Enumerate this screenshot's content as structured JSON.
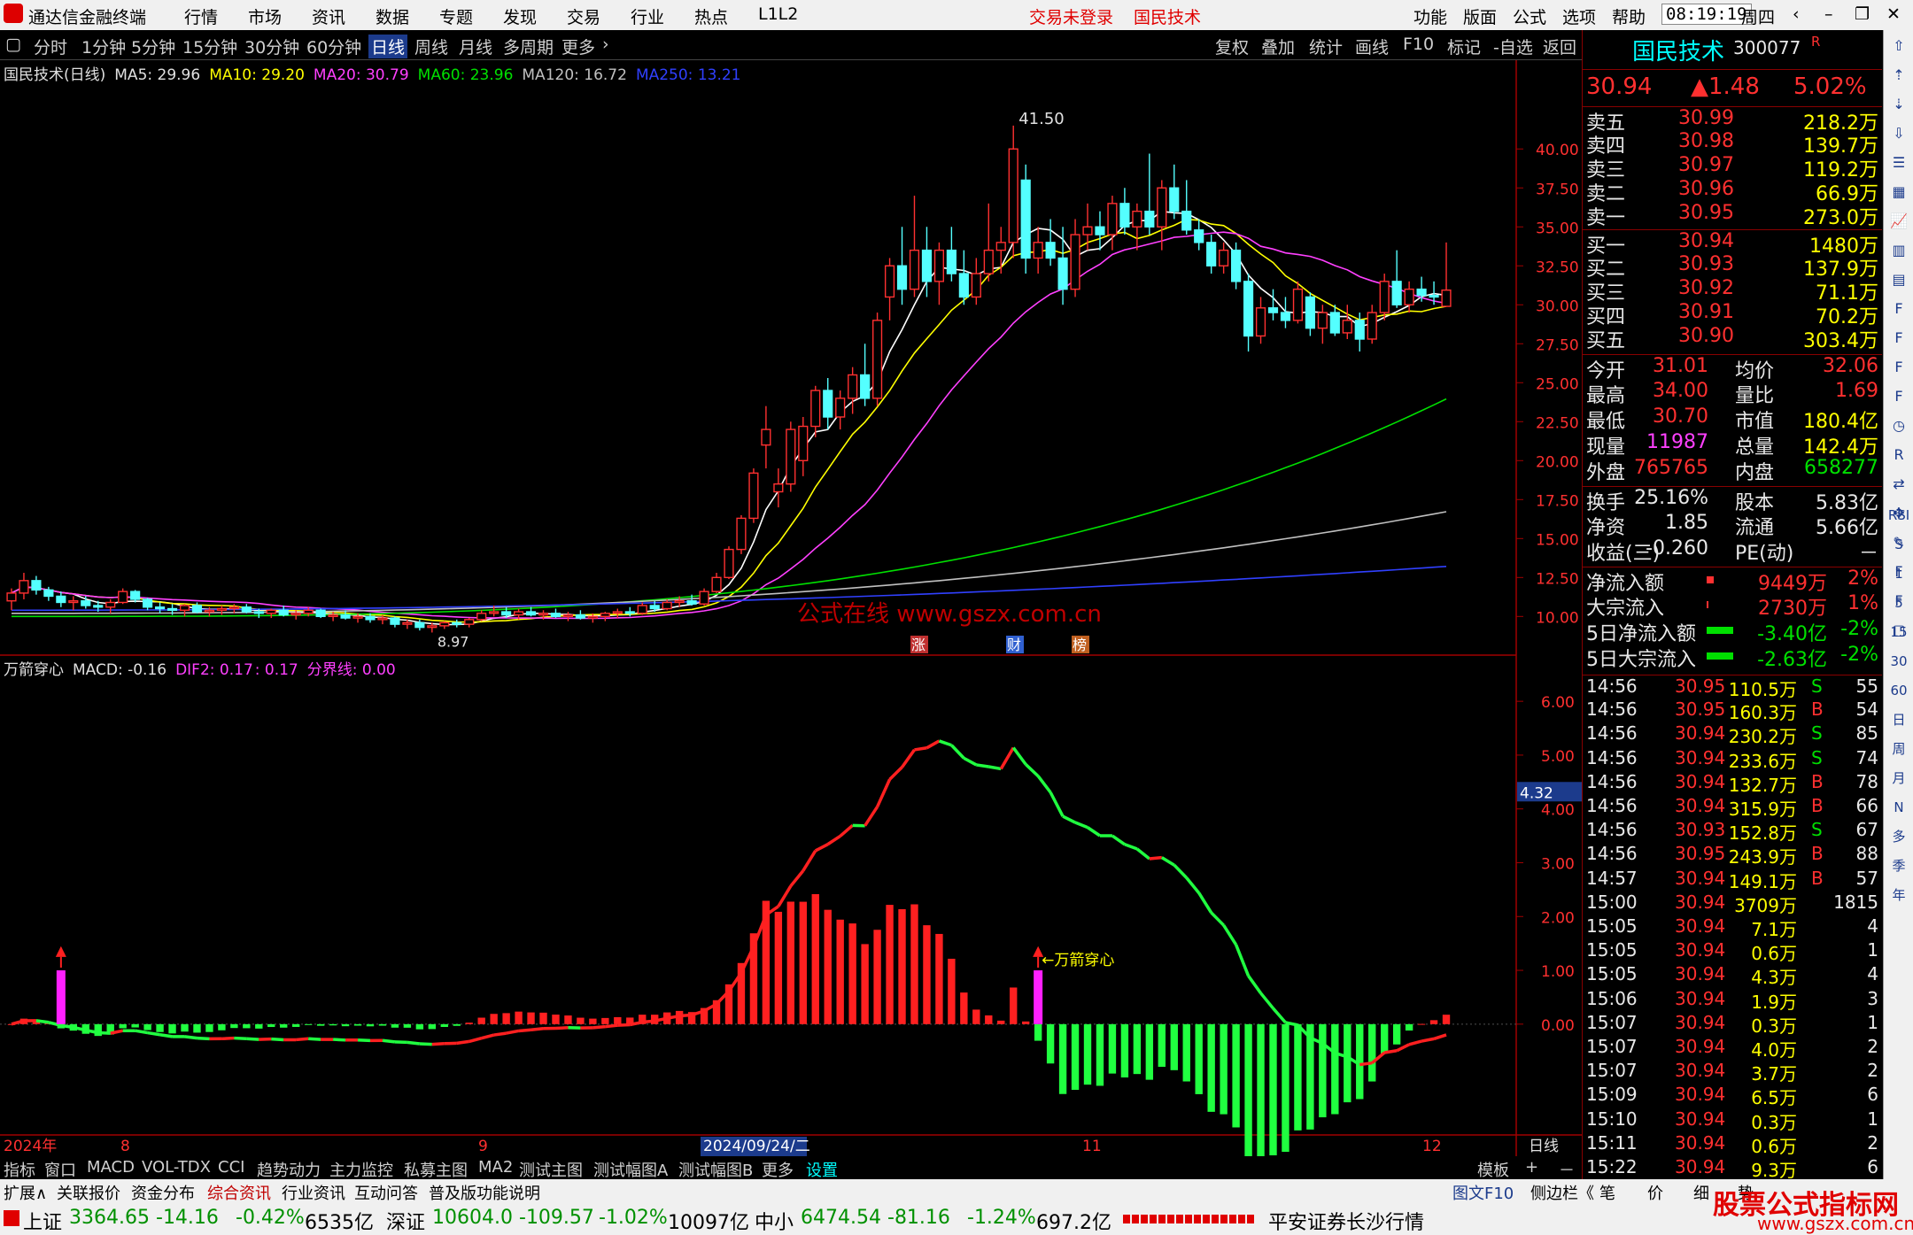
{
  "app": {
    "title": "通达信金融终端",
    "menus": [
      "行情",
      "市场",
      "资讯",
      "数据",
      "专题",
      "发现",
      "交易",
      "行业",
      "热点",
      "L1L2"
    ],
    "login_status": "交易未登录",
    "stock_header": "国民技术",
    "right_menus": [
      "功能",
      "版面",
      "公式",
      "选项",
      "帮助"
    ],
    "clock": "08:19:19",
    "weekday": "周四"
  },
  "periods": [
    "分时",
    "1分钟",
    "5分钟",
    "15分钟",
    "30分钟",
    "60分钟",
    "日线",
    "周线",
    "月线",
    "多周期",
    "更多"
  ],
  "active_period": "日线",
  "tools": [
    "复权",
    "叠加",
    "统计",
    "画线",
    "F10",
    "标记",
    "-自选",
    "返回"
  ],
  "main_legend": {
    "name": "国民技术(日线)",
    "ma5": "MA5: 29.96",
    "ma10": "MA10: 29.20",
    "ma20": "MA20: 30.79",
    "ma60": "MA60: 23.96",
    "ma120": "MA120: 16.72",
    "ma250": "MA250: 13.21"
  },
  "price_axis": [
    "40.00",
    "37.50",
    "35.00",
    "32.50",
    "30.00",
    "27.50",
    "25.00",
    "22.50",
    "20.00",
    "17.50",
    "15.00",
    "12.50",
    "10.00"
  ],
  "high_label": "41.50",
  "low_label": "8.97",
  "watermark": "公式在线  www.gszx.com.cn",
  "event_tags": [
    "涨",
    "财",
    "榜"
  ],
  "ind_legend": {
    "name": "万箭穿心",
    "macd": "MACD: -0.16",
    "dif2": "DIF2: 0.17",
    "dif2b": ": 0.17",
    "line": "分界线: 0.00"
  },
  "ind_axis": [
    "6.00",
    "5.00",
    "4.00",
    "3.00",
    "2.00",
    "1.00",
    "0.00"
  ],
  "ind_cursor": "4.32",
  "signal_label": "←万箭穿心",
  "date_axis": {
    "labels": [
      "2024年",
      "8",
      "9",
      "2024/09/24/二",
      "11",
      "12"
    ],
    "right": "日线"
  },
  "colors": {
    "up": "#ff3030",
    "down": "#54ffff",
    "ma5": "#ffffff",
    "ma10": "#ffff00",
    "ma20": "#ff40ff",
    "ma60": "#00e000",
    "ma120": "#c0c0c0",
    "ma250": "#3040ff",
    "macd_up": "#ff2020",
    "macd_dn": "#20ff40",
    "signal": "#ff20ff"
  },
  "quote": {
    "name": "国民技术",
    "code": "300077",
    "tag": "R",
    "price": "30.94",
    "change": "▲1.48",
    "pct": "5.02%",
    "asks": [
      {
        "l": "卖五",
        "p": "30.99",
        "v": "218.2万"
      },
      {
        "l": "卖四",
        "p": "30.98",
        "v": "139.7万"
      },
      {
        "l": "卖三",
        "p": "30.97",
        "v": "119.2万"
      },
      {
        "l": "卖二",
        "p": "30.96",
        "v": "66.9万"
      },
      {
        "l": "卖一",
        "p": "30.95",
        "v": "273.0万"
      }
    ],
    "bids": [
      {
        "l": "买一",
        "p": "30.94",
        "v": "1480万"
      },
      {
        "l": "买二",
        "p": "30.93",
        "v": "137.9万"
      },
      {
        "l": "买三",
        "p": "30.92",
        "v": "71.1万"
      },
      {
        "l": "买四",
        "p": "30.91",
        "v": "70.2万"
      },
      {
        "l": "买五",
        "p": "30.90",
        "v": "303.4万"
      }
    ],
    "stats": [
      [
        "今开",
        "31.01",
        "均价",
        "32.06"
      ],
      [
        "最高",
        "34.00",
        "量比",
        "1.69"
      ],
      [
        "最低",
        "30.70",
        "市值",
        "180.4亿"
      ],
      [
        "现量",
        "11987",
        "总量",
        "142.4万"
      ],
      [
        "外盘",
        "765765",
        "内盘",
        "658277"
      ]
    ],
    "fund": [
      [
        "换手",
        "25.16%",
        "股本",
        "5.83亿"
      ],
      [
        "净资",
        "1.85",
        "流通",
        "5.66亿"
      ],
      [
        "收益(三)",
        "-0.260",
        "PE(动)",
        "－"
      ]
    ],
    "flows": [
      [
        "净流入额",
        "9449万",
        "2%"
      ],
      [
        "大宗流入",
        "2730万",
        "1%"
      ],
      [
        "5日净流入额",
        "-3.40亿",
        "-2%"
      ],
      [
        "5日大宗流入",
        "-2.63亿",
        "-2%"
      ]
    ]
  },
  "ticks": [
    [
      "14:56",
      "30.95",
      "110.5万",
      "S",
      "55"
    ],
    [
      "14:56",
      "30.95",
      "160.3万",
      "B",
      "54"
    ],
    [
      "14:56",
      "30.94",
      "230.2万",
      "S",
      "85"
    ],
    [
      "14:56",
      "30.94",
      "233.6万",
      "S",
      "74"
    ],
    [
      "14:56",
      "30.94",
      "132.7万",
      "B",
      "78"
    ],
    [
      "14:56",
      "30.94",
      "315.9万",
      "B",
      "66"
    ],
    [
      "14:56",
      "30.93",
      "152.8万",
      "S",
      "67"
    ],
    [
      "14:56",
      "30.95",
      "243.9万",
      "B",
      "88"
    ],
    [
      "14:57",
      "30.94",
      "149.1万",
      "B",
      "57"
    ],
    [
      "15:00",
      "30.94",
      "3709万",
      "",
      "1815"
    ],
    [
      "15:05",
      "30.94",
      "7.1万",
      "",
      "4"
    ],
    [
      "15:05",
      "30.94",
      "0.6万",
      "",
      "1"
    ],
    [
      "15:05",
      "30.94",
      "4.3万",
      "",
      "4"
    ],
    [
      "15:06",
      "30.94",
      "1.9万",
      "",
      "3"
    ],
    [
      "15:07",
      "30.94",
      "0.3万",
      "",
      "1"
    ],
    [
      "15:07",
      "30.94",
      "4.0万",
      "",
      "2"
    ],
    [
      "15:07",
      "30.94",
      "3.7万",
      "",
      "2"
    ],
    [
      "15:09",
      "30.94",
      "6.5万",
      "",
      "6"
    ],
    [
      "15:10",
      "30.94",
      "0.3万",
      "",
      "1"
    ],
    [
      "15:11",
      "30.94",
      "0.6万",
      "",
      "2"
    ],
    [
      "15:22",
      "30.94",
      "9.3万",
      "",
      "6"
    ]
  ],
  "icons": [
    "up-icon",
    "up2-icon",
    "down2-icon",
    "down-icon",
    "list-icon",
    "grid-icon",
    "line-icon",
    "bar-icon",
    "table-icon",
    "f10-icon",
    "f1-icon",
    "f2-icon",
    "f3-icon",
    "clock-icon",
    "rsi-icon",
    "arrow-icon",
    "drag-icon",
    "pen-icon",
    "f5-icon",
    "f6-icon",
    "box-icon"
  ],
  "icon_labels": [
    "RSI",
    "S",
    "1",
    "5",
    "15",
    "30",
    "60",
    "日",
    "周",
    "月",
    "N",
    "多",
    "季",
    "年"
  ],
  "bottom_tabs": [
    "指标",
    "窗口",
    "MACD",
    "VOL-TDX",
    "CCI",
    "趋势动力",
    "主力监控",
    "私募主图",
    "MA2",
    "测试主图",
    "测试幅图A",
    "测试幅图B",
    "更多",
    "设置"
  ],
  "bottom_right": [
    "模板",
    "+",
    "－"
  ],
  "bottom_tabs2": [
    "扩展∧",
    "关联报价",
    "资金分布",
    "综合资讯",
    "行业资讯",
    "互动问答",
    "普及版功能说明"
  ],
  "bottom_right2": [
    "图文F10",
    "侧边栏《",
    "笔",
    "价",
    "细",
    "势"
  ],
  "status": [
    {
      "n": "上证",
      "v": "3364.65",
      "c": "-14.16",
      "p": "-0.42%",
      "a": "6535亿"
    },
    {
      "n": "深证",
      "v": "10604.0",
      "c": "-109.57",
      "p": "-1.02%",
      "a": "10097亿"
    },
    {
      "n": "中小",
      "v": "6474.54",
      "c": "-81.16",
      "p": "-1.24%",
      "a": "697.2亿"
    }
  ],
  "status_right": "平安证券长沙行情",
  "brand": "股票公式指标网",
  "brand_url": "www.gszx.com.cn",
  "chart_data": {
    "type": "candlestick+macd",
    "price_range": [
      8.97,
      41.5
    ],
    "ind_range": [
      -1.5,
      6.0
    ],
    "candles": [
      [
        11.0,
        11.8,
        10.4,
        11.5
      ],
      [
        11.5,
        12.8,
        11.1,
        12.3
      ],
      [
        12.3,
        12.6,
        11.4,
        11.7
      ],
      [
        11.7,
        11.9,
        11.0,
        11.3
      ],
      [
        11.3,
        11.6,
        10.6,
        10.9
      ],
      [
        10.9,
        11.3,
        10.4,
        11.0
      ],
      [
        11.0,
        11.3,
        10.5,
        10.7
      ],
      [
        10.7,
        11.0,
        10.3,
        10.6
      ],
      [
        10.6,
        11.1,
        10.2,
        10.9
      ],
      [
        10.9,
        11.8,
        10.8,
        11.6
      ],
      [
        11.6,
        11.7,
        10.9,
        11.1
      ],
      [
        11.1,
        11.2,
        10.4,
        10.6
      ],
      [
        10.6,
        10.9,
        10.2,
        10.5
      ],
      [
        10.5,
        10.8,
        10.1,
        10.4
      ],
      [
        10.4,
        10.8,
        10.0,
        10.7
      ],
      [
        10.7,
        10.9,
        10.2,
        10.3
      ],
      [
        10.3,
        10.6,
        10.0,
        10.4
      ],
      [
        10.4,
        10.7,
        10.1,
        10.5
      ],
      [
        10.5,
        10.8,
        10.2,
        10.6
      ],
      [
        10.6,
        10.8,
        10.2,
        10.3
      ],
      [
        10.3,
        10.5,
        9.9,
        10.2
      ],
      [
        10.2,
        10.5,
        9.9,
        10.4
      ],
      [
        10.4,
        10.7,
        10.0,
        10.1
      ],
      [
        10.1,
        10.4,
        9.8,
        10.2
      ],
      [
        10.2,
        10.6,
        10.0,
        10.4
      ],
      [
        10.4,
        10.5,
        9.9,
        10.0
      ],
      [
        10.0,
        10.3,
        9.7,
        10.1
      ],
      [
        10.1,
        10.4,
        9.8,
        9.9
      ],
      [
        9.9,
        10.2,
        9.6,
        10.0
      ],
      [
        10.0,
        10.2,
        9.6,
        9.8
      ],
      [
        9.8,
        10.1,
        9.5,
        9.9
      ],
      [
        9.9,
        10.0,
        9.3,
        9.5
      ],
      [
        9.5,
        9.8,
        9.2,
        9.6
      ],
      [
        9.6,
        9.8,
        9.1,
        9.3
      ],
      [
        9.3,
        9.6,
        8.97,
        9.4
      ],
      [
        9.4,
        9.7,
        9.2,
        9.6
      ],
      [
        9.6,
        9.8,
        9.3,
        9.5
      ],
      [
        9.5,
        9.9,
        9.3,
        9.8
      ],
      [
        9.8,
        10.4,
        9.7,
        10.2
      ],
      [
        10.2,
        10.7,
        10.0,
        10.3
      ],
      [
        10.3,
        10.6,
        9.9,
        10.1
      ],
      [
        10.1,
        10.5,
        9.8,
        10.3
      ],
      [
        10.3,
        10.6,
        10.0,
        10.1
      ],
      [
        10.1,
        10.4,
        9.8,
        10.2
      ],
      [
        10.2,
        10.5,
        9.9,
        10.0
      ],
      [
        10.0,
        10.3,
        9.7,
        10.1
      ],
      [
        10.1,
        10.4,
        9.8,
        9.9
      ],
      [
        9.9,
        10.2,
        9.6,
        10.0
      ],
      [
        10.0,
        10.3,
        9.7,
        10.2
      ],
      [
        10.2,
        10.5,
        9.9,
        10.3
      ],
      [
        10.3,
        10.6,
        10.0,
        10.2
      ],
      [
        10.2,
        10.9,
        10.1,
        10.7
      ],
      [
        10.7,
        11.0,
        10.3,
        10.5
      ],
      [
        10.5,
        11.1,
        10.4,
        10.9
      ],
      [
        10.9,
        11.3,
        10.6,
        11.0
      ],
      [
        11.0,
        11.4,
        10.7,
        10.8
      ],
      [
        10.8,
        11.8,
        10.7,
        11.6
      ],
      [
        11.6,
        12.8,
        11.5,
        12.5
      ],
      [
        12.5,
        14.5,
        12.4,
        14.3
      ],
      [
        14.3,
        16.5,
        14.0,
        16.3
      ],
      [
        16.3,
        19.5,
        16.0,
        19.2
      ],
      [
        21.0,
        23.5,
        19.5,
        22.0
      ],
      [
        18.0,
        19.5,
        17.0,
        18.5
      ],
      [
        18.5,
        22.5,
        18.0,
        22.0
      ],
      [
        20.0,
        22.8,
        19.0,
        22.2
      ],
      [
        22.2,
        24.8,
        21.5,
        24.5
      ],
      [
        24.5,
        25.3,
        22.0,
        22.8
      ],
      [
        22.8,
        24.5,
        22.0,
        24.0
      ],
      [
        24.0,
        26.0,
        23.0,
        25.5
      ],
      [
        25.5,
        27.5,
        23.5,
        24.0
      ],
      [
        24.0,
        29.5,
        23.5,
        29.0
      ],
      [
        30.5,
        33.0,
        29.0,
        32.5
      ],
      [
        32.5,
        35.0,
        30.0,
        31.0
      ],
      [
        31.0,
        37.0,
        30.5,
        33.5
      ],
      [
        33.5,
        35.0,
        30.5,
        31.5
      ],
      [
        31.5,
        34.0,
        30.0,
        33.5
      ],
      [
        33.5,
        35.0,
        31.5,
        32.0
      ],
      [
        32.0,
        33.5,
        30.0,
        30.5
      ],
      [
        30.5,
        33.0,
        30.0,
        32.0
      ],
      [
        32.0,
        36.5,
        31.5,
        33.5
      ],
      [
        33.5,
        35.0,
        32.0,
        34.0
      ],
      [
        34.0,
        41.5,
        33.0,
        40.0
      ],
      [
        38.0,
        39.0,
        32.0,
        33.0
      ],
      [
        33.0,
        35.0,
        32.0,
        34.0
      ],
      [
        34.0,
        35.5,
        32.5,
        33.0
      ],
      [
        33.0,
        35.0,
        30.0,
        31.0
      ],
      [
        31.0,
        35.5,
        30.5,
        34.5
      ],
      [
        34.5,
        36.5,
        33.5,
        35.0
      ],
      [
        35.0,
        36.0,
        33.5,
        34.5
      ],
      [
        34.5,
        37.0,
        33.5,
        36.5
      ],
      [
        36.5,
        37.5,
        34.5,
        35.0
      ],
      [
        35.0,
        36.5,
        33.5,
        36.0
      ],
      [
        36.0,
        39.7,
        34.5,
        35.0
      ],
      [
        35.0,
        38.0,
        33.5,
        37.5
      ],
      [
        37.5,
        39.0,
        35.5,
        36.0
      ],
      [
        36.0,
        38.0,
        34.5,
        34.8
      ],
      [
        34.8,
        35.5,
        33.5,
        34.0
      ],
      [
        34.0,
        34.5,
        32.0,
        32.5
      ],
      [
        32.5,
        34.0,
        32.0,
        33.5
      ],
      [
        33.5,
        34.0,
        31.0,
        31.5
      ],
      [
        31.5,
        32.0,
        27.0,
        28.0
      ],
      [
        28.0,
        30.5,
        27.5,
        29.8
      ],
      [
        29.8,
        31.0,
        29.0,
        29.5
      ],
      [
        29.5,
        30.5,
        28.5,
        29.0
      ],
      [
        29.0,
        31.5,
        28.8,
        31.0
      ],
      [
        30.5,
        30.8,
        28.0,
        28.5
      ],
      [
        28.5,
        30.0,
        27.5,
        29.5
      ],
      [
        29.5,
        30.0,
        28.0,
        28.2
      ],
      [
        28.2,
        30.0,
        27.8,
        29.0
      ],
      [
        29.0,
        29.5,
        27.0,
        27.8
      ],
      [
        27.8,
        30.0,
        27.5,
        29.5
      ],
      [
        29.5,
        32.0,
        29.0,
        31.5
      ],
      [
        31.5,
        33.5,
        29.8,
        30.0
      ],
      [
        30.0,
        31.5,
        29.5,
        31.0
      ],
      [
        31.0,
        31.8,
        30.2,
        30.6
      ],
      [
        30.6,
        31.5,
        30.0,
        30.5
      ],
      [
        29.9,
        34.0,
        30.7,
        30.94
      ]
    ]
  }
}
